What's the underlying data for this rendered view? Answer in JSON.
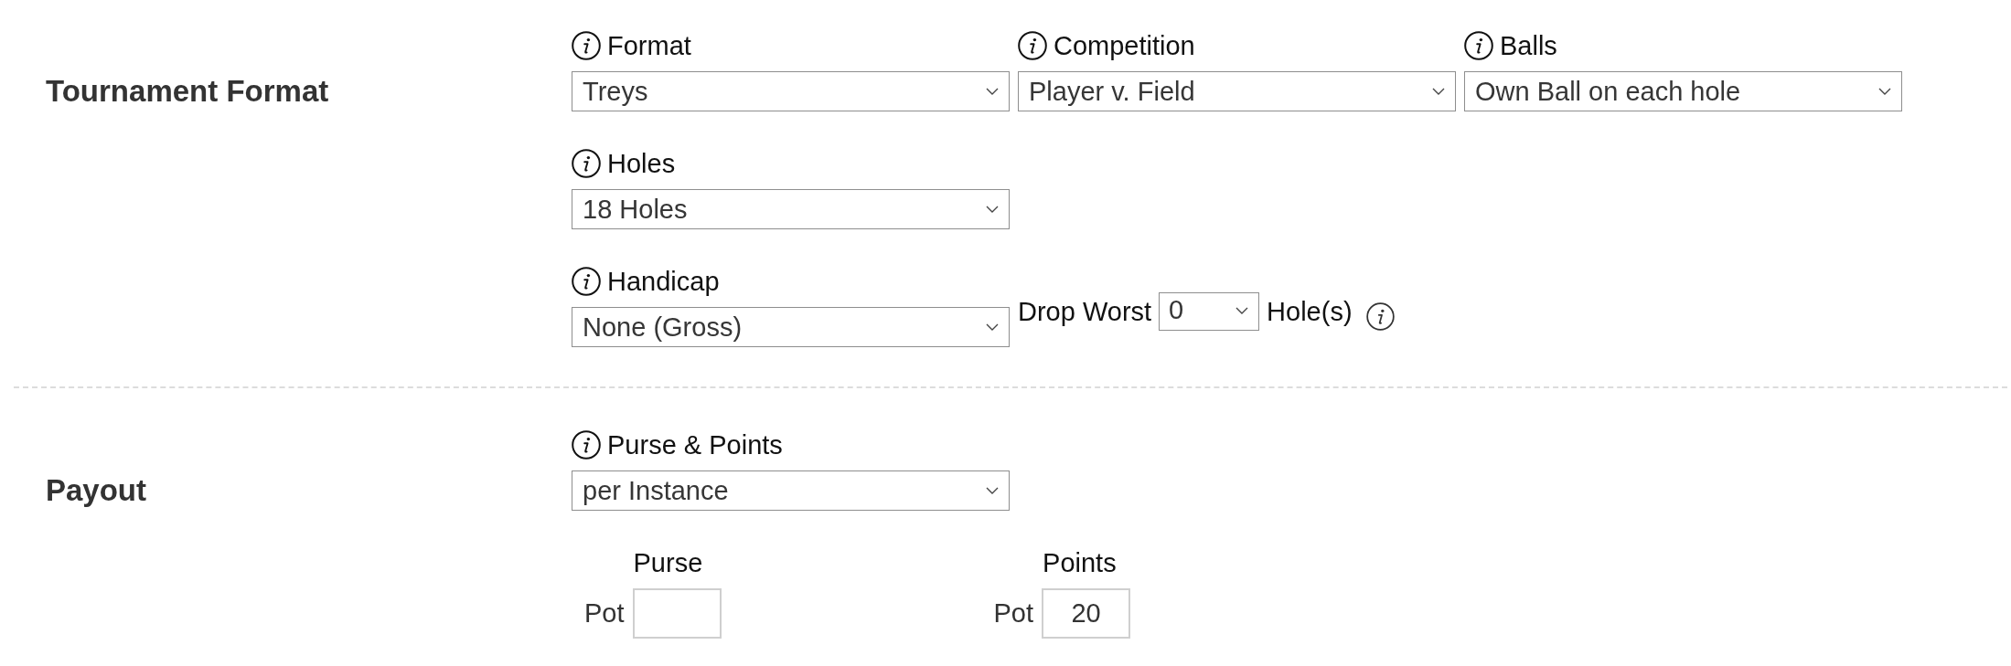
{
  "sections": [
    {
      "heading": "Tournament Format",
      "rows": [
        {
          "fields": [
            {
              "kind": "select",
              "label": "Format",
              "info": true,
              "value": "Treys"
            },
            {
              "kind": "select",
              "label": "Competition",
              "info": true,
              "value": "Player v. Field"
            },
            {
              "kind": "select",
              "label": "Balls",
              "info": true,
              "value": "Own Ball on each hole"
            }
          ]
        },
        {
          "fields": [
            {
              "kind": "select",
              "label": "Holes",
              "info": true,
              "value": "18 Holes"
            }
          ]
        },
        {
          "fields": [
            {
              "kind": "select",
              "label": "Handicap",
              "info": true,
              "value": "None (Gross)"
            },
            {
              "kind": "inline_select",
              "prefix": "Drop Worst",
              "value": "0",
              "suffix": "Hole(s)",
              "info": true
            }
          ]
        }
      ]
    },
    {
      "heading": "Payout",
      "rows": [
        {
          "fields": [
            {
              "kind": "select",
              "label": "Purse & Points",
              "info": true,
              "value": "per Instance"
            }
          ]
        },
        {
          "fields": [
            {
              "kind": "pot",
              "label": "Purse",
              "prefix": "Pot"
            },
            {
              "kind": "pot",
              "label": "Points",
              "prefix": "Pot",
              "value": "20"
            }
          ]
        }
      ]
    }
  ]
}
